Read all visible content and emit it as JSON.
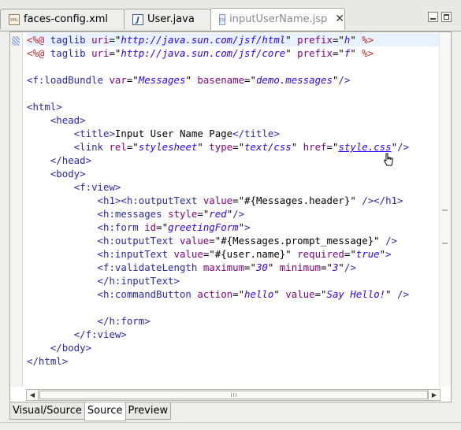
{
  "tabs": [
    {
      "label": "faces-config.xml",
      "icon": "xml-file-icon"
    },
    {
      "label": "User.java",
      "icon": "java-file-icon"
    },
    {
      "label": "inputUserName.jsp",
      "icon": "jsp-file-icon",
      "active": true
    }
  ],
  "tab_icon_text": {
    "xml": "XML",
    "java": "J",
    "jsp": "JSP"
  },
  "editor_lines": [
    [
      [
        "d",
        "<%@ "
      ],
      [
        "t",
        "taglib "
      ],
      [
        "a",
        "uri"
      ],
      [
        "p",
        "=\""
      ],
      [
        "v",
        "http://java.sun.com/jsf/html"
      ],
      [
        "p",
        "\" "
      ],
      [
        "a",
        "prefix"
      ],
      [
        "p",
        "=\""
      ],
      [
        "v",
        "h"
      ],
      [
        "p",
        "\" "
      ],
      [
        "d",
        "%>"
      ]
    ],
    [
      [
        "d",
        "<%@ "
      ],
      [
        "t",
        "taglib "
      ],
      [
        "a",
        "uri"
      ],
      [
        "p",
        "=\""
      ],
      [
        "v",
        "http://java.sun.com/jsf/core"
      ],
      [
        "p",
        "\" "
      ],
      [
        "a",
        "prefix"
      ],
      [
        "p",
        "=\""
      ],
      [
        "v",
        "f"
      ],
      [
        "p",
        "\" "
      ],
      [
        "d",
        "%>"
      ]
    ],
    [],
    [
      [
        "t",
        "<f:loadBundle "
      ],
      [
        "a",
        "var"
      ],
      [
        "p",
        "=\""
      ],
      [
        "v",
        "Messages"
      ],
      [
        "p",
        "\" "
      ],
      [
        "a",
        "basename"
      ],
      [
        "p",
        "=\""
      ],
      [
        "v",
        "demo.messages"
      ],
      [
        "p",
        "\""
      ],
      [
        "t",
        "/>"
      ]
    ],
    [],
    [
      [
        "t",
        "<html>"
      ]
    ],
    [
      [
        "p",
        "    "
      ],
      [
        "t",
        "<head>"
      ]
    ],
    [
      [
        "p",
        "        "
      ],
      [
        "t",
        "<title>"
      ],
      [
        "p",
        "Input User Name Page"
      ],
      [
        "t",
        "</title>"
      ]
    ],
    [
      [
        "p",
        "        "
      ],
      [
        "t",
        "<link "
      ],
      [
        "a",
        "rel"
      ],
      [
        "p",
        "=\""
      ],
      [
        "v",
        "stylesheet"
      ],
      [
        "p",
        "\" "
      ],
      [
        "a",
        "type"
      ],
      [
        "p",
        "=\""
      ],
      [
        "v",
        "text/css"
      ],
      [
        "p",
        "\" "
      ],
      [
        "a",
        "href"
      ],
      [
        "p",
        "=\""
      ],
      [
        "l",
        "style.css"
      ],
      [
        "p",
        "\""
      ],
      [
        "t",
        "/>"
      ]
    ],
    [
      [
        "p",
        "    "
      ],
      [
        "t",
        "</head>"
      ]
    ],
    [
      [
        "p",
        "    "
      ],
      [
        "t",
        "<body>"
      ]
    ],
    [
      [
        "p",
        "        "
      ],
      [
        "t",
        "<f:view>"
      ]
    ],
    [
      [
        "p",
        "            "
      ],
      [
        "t",
        "<h1><h:outputText "
      ],
      [
        "a",
        "value"
      ],
      [
        "p",
        "=\"#{Messages.header}\" "
      ],
      [
        "t",
        "/></h1>"
      ]
    ],
    [
      [
        "p",
        "            "
      ],
      [
        "t",
        "<h:messages "
      ],
      [
        "a",
        "style"
      ],
      [
        "p",
        "=\""
      ],
      [
        "v",
        "red"
      ],
      [
        "p",
        "\""
      ],
      [
        "t",
        "/>"
      ]
    ],
    [
      [
        "p",
        "            "
      ],
      [
        "t",
        "<h:form "
      ],
      [
        "a",
        "id"
      ],
      [
        "p",
        "=\""
      ],
      [
        "v",
        "greetingForm"
      ],
      [
        "p",
        "\""
      ],
      [
        "t",
        ">"
      ]
    ],
    [
      [
        "p",
        "            "
      ],
      [
        "t",
        "<h:outputText "
      ],
      [
        "a",
        "value"
      ],
      [
        "p",
        "=\"#{Messages.prompt_message}\" "
      ],
      [
        "t",
        "/>"
      ]
    ],
    [
      [
        "p",
        "            "
      ],
      [
        "t",
        "<h:inputText "
      ],
      [
        "a",
        "value"
      ],
      [
        "p",
        "=\"#{user.name}\" "
      ],
      [
        "a",
        "required"
      ],
      [
        "p",
        "=\""
      ],
      [
        "v",
        "true"
      ],
      [
        "p",
        "\""
      ],
      [
        "t",
        ">"
      ]
    ],
    [
      [
        "p",
        "            "
      ],
      [
        "t",
        "<f:validateLength "
      ],
      [
        "a",
        "maximum"
      ],
      [
        "p",
        "=\""
      ],
      [
        "v",
        "30"
      ],
      [
        "p",
        "\" "
      ],
      [
        "a",
        "minimum"
      ],
      [
        "p",
        "=\""
      ],
      [
        "v",
        "3"
      ],
      [
        "p",
        "\""
      ],
      [
        "t",
        "/>"
      ]
    ],
    [
      [
        "p",
        "            "
      ],
      [
        "t",
        "</h:inputText>"
      ]
    ],
    [
      [
        "p",
        "            "
      ],
      [
        "t",
        "<h:commandButton "
      ],
      [
        "a",
        "action"
      ],
      [
        "p",
        "=\""
      ],
      [
        "v",
        "hello"
      ],
      [
        "p",
        "\" "
      ],
      [
        "a",
        "value"
      ],
      [
        "p",
        "=\""
      ],
      [
        "v",
        "Say Hello!"
      ],
      [
        "p",
        "\" "
      ],
      [
        "t",
        "/>"
      ]
    ],
    [],
    [
      [
        "p",
        "            "
      ],
      [
        "t",
        "</h:form>"
      ]
    ],
    [
      [
        "p",
        "        "
      ],
      [
        "t",
        "</f:view>"
      ]
    ],
    [
      [
        "p",
        "    "
      ],
      [
        "t",
        "</body>"
      ]
    ],
    [
      [
        "t",
        "</html>"
      ]
    ]
  ],
  "highlighted_line": 0,
  "bottom_tabs": [
    {
      "label": "Visual/Source"
    },
    {
      "label": "Source",
      "active": true
    },
    {
      "label": "Preview"
    }
  ],
  "colors": {
    "directive": "#c32b2b",
    "tag": "#2929a8",
    "attribute": "#7f007f",
    "value": "#2a00ff",
    "current_line": "#e8f2fe"
  }
}
